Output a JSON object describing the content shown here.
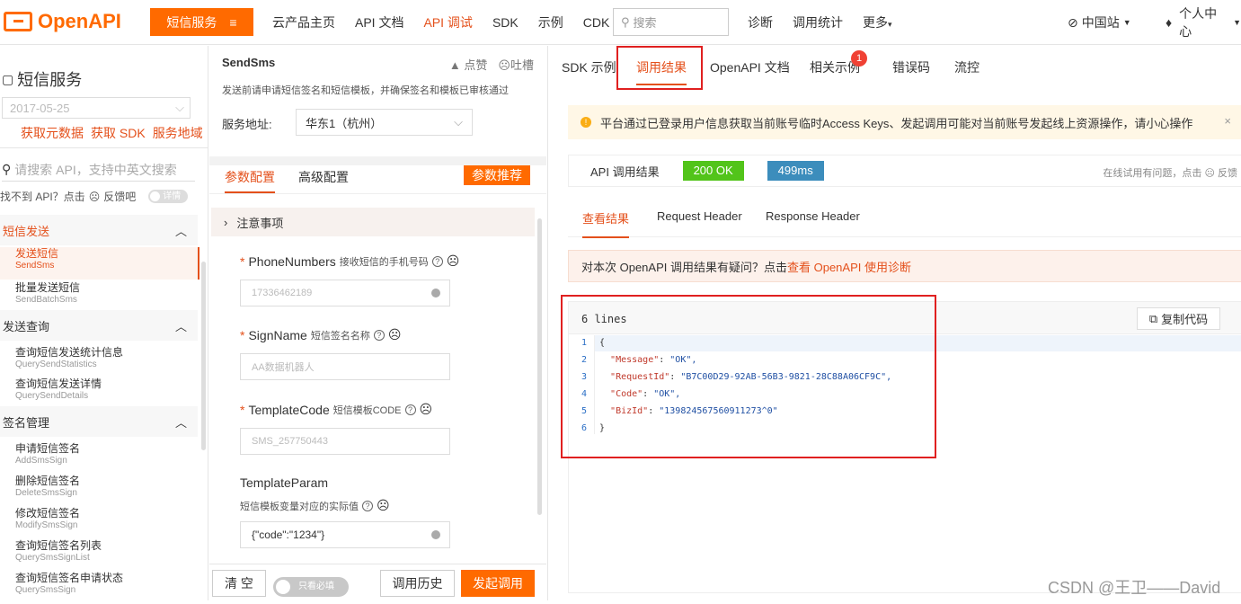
{
  "header": {
    "logo": "OpenAPI",
    "product_button": "短信服务",
    "product_menu_icon": "≡",
    "nav": [
      "云产品主页",
      "API 文档",
      "API 调试",
      "SDK",
      "示例",
      "CDK"
    ],
    "search_placeholder": "搜索",
    "right_nav": [
      "诊断",
      "调用统计",
      "更多"
    ],
    "region": "中国站",
    "user": "个人中心"
  },
  "left": {
    "service_title": "短信服务",
    "version": "2017-05-25",
    "links": [
      "获取元数据",
      "获取 SDK",
      "服务地域"
    ],
    "search_placeholder": "请搜索 API，支持中英文搜索",
    "feedback": "找不到 API？点击",
    "feedback_link": "反馈吧",
    "detail_toggle": "详情",
    "groups": [
      {
        "label": "短信发送",
        "items": [
          {
            "name": "发送短信",
            "sub": "SendSms",
            "active": true
          },
          {
            "name": "批量发送短信",
            "sub": "SendBatchSms"
          }
        ]
      },
      {
        "label": "发送查询",
        "items": [
          {
            "name": "查询短信发送统计信息",
            "sub": "QuerySendStatistics"
          },
          {
            "name": "查询短信发送详情",
            "sub": "QuerySendDetails"
          }
        ]
      },
      {
        "label": "签名管理",
        "items": [
          {
            "name": "申请短信签名",
            "sub": "AddSmsSign"
          },
          {
            "name": "删除短信签名",
            "sub": "DeleteSmsSign"
          },
          {
            "name": "修改短信签名",
            "sub": "ModifySmsSign"
          },
          {
            "name": "查询短信签名列表",
            "sub": "QuerySmsSignList"
          },
          {
            "name": "查询短信签名申请状态",
            "sub": "QuerySmsSign"
          }
        ]
      }
    ]
  },
  "mid": {
    "api_name": "SendSms",
    "like": "点赞",
    "dislike": "吐槽",
    "desc": "发送前请申请短信签名和短信模板，并确保签名和模板已审核通过",
    "addr_label": "服务地址:",
    "addr_value": "华东1（杭州）",
    "tab_params": "参数配置",
    "tab_advanced": "高级配置",
    "recommend": "参数推荐",
    "notice": "注意事项",
    "fields": [
      {
        "name": "PhoneNumbers",
        "hint": "接收短信的手机号码",
        "required": true,
        "value": "17336462189"
      },
      {
        "name": "SignName",
        "hint": "短信签名名称",
        "required": true,
        "value": "AA数据机器人"
      },
      {
        "name": "TemplateCode",
        "hint": "短信模板CODE",
        "required": true,
        "value": "SMS_257750443"
      },
      {
        "name": "TemplateParam",
        "hint": "短信模板变量对应的实际值",
        "required": false,
        "value": "{\"code\":\"1234\"}"
      }
    ],
    "clear": "清 空",
    "required_only": "只看必填",
    "history": "调用历史",
    "invoke": "发起调用"
  },
  "right": {
    "tabs": [
      "SDK 示例",
      "调用结果",
      "OpenAPI 文档",
      "相关示例",
      "错误码",
      "流控"
    ],
    "badge": "1",
    "warning": "平台通过已登录用户信息获取当前账号临时Access Keys、发起调用可能对当前账号发起线上资源操作，请小心操作",
    "warning_close": "×",
    "result_label": "API 调用结果",
    "status": "200 OK",
    "latency": "499ms",
    "help": "在线试用有问题，点击",
    "help_link": "反馈",
    "sub_tabs": [
      "查看结果",
      "Request Header",
      "Response Header"
    ],
    "diag_text": "对本次 OpenAPI 调用结果有疑问？点击",
    "diag_link": "查看 OpenAPI 使用诊断",
    "lines_label": "6 lines",
    "copy": "复制代码",
    "code": [
      {
        "n": "1",
        "text": "{"
      },
      {
        "n": "2",
        "key": "\"Message\"",
        "val": "\"OK\","
      },
      {
        "n": "3",
        "key": "\"RequestId\"",
        "val": "\"B7C00D29-92AB-56B3-9821-28C88A06CF9C\","
      },
      {
        "n": "4",
        "key": "\"Code\"",
        "val": "\"OK\","
      },
      {
        "n": "5",
        "key": "\"BizId\"",
        "val": "\"139824567560911273^0\""
      },
      {
        "n": "6",
        "text": "}"
      }
    ]
  },
  "watermark": "CSDN @王卫——David",
  "colors": {
    "accent": "#ff6a00",
    "success": "#52c41a",
    "info": "#3c8dbc",
    "highlight": "#e02020"
  }
}
